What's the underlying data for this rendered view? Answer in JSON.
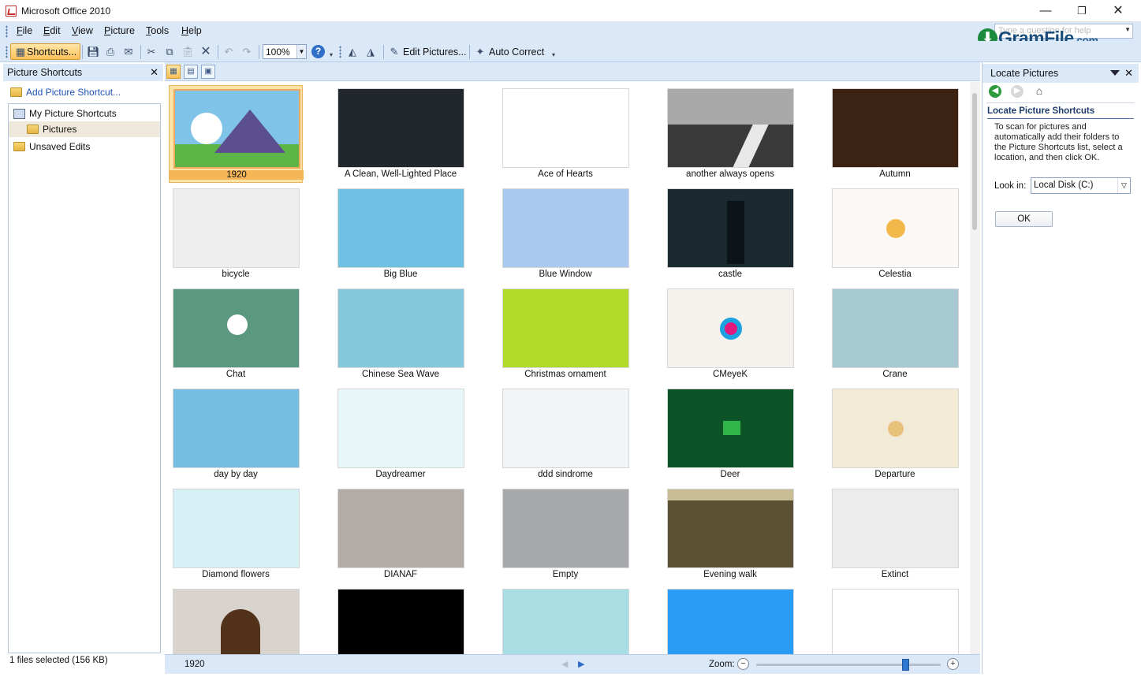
{
  "window": {
    "title": "Microsoft Office 2010"
  },
  "menu": {
    "items": [
      "File",
      "Edit",
      "View",
      "Picture",
      "Tools",
      "Help"
    ],
    "help_placeholder": "Type a question for help"
  },
  "watermark": {
    "text": "GramFile",
    "suffix": ".com"
  },
  "toolbar": {
    "shortcuts_label": "Shortcuts...",
    "zoom_value": "100%",
    "edit_pictures_label": "Edit Pictures...",
    "auto_correct_label": "Auto Correct"
  },
  "left_panel": {
    "title": "Picture Shortcuts",
    "add_link": "Add Picture Shortcut...",
    "tree": [
      "My Picture Shortcuts",
      "Pictures",
      "Unsaved Edits"
    ],
    "status": "1 files selected (156 KB)"
  },
  "gallery": {
    "selected": "1920",
    "items": [
      "1920",
      "A Clean, Well-Lighted Place",
      "Ace of Hearts",
      "another always opens",
      "Autumn",
      "bicycle",
      "Big Blue",
      "Blue Window",
      "castle",
      "Celestia",
      "Chat",
      "Chinese Sea Wave",
      "Christmas ornament",
      "CMeyeK",
      "Crane",
      "day by day",
      "Daydreamer",
      "ddd sindrome",
      "Deer",
      "Departure",
      "Diamond flowers",
      "DIANAF",
      "Empty",
      "Evening walk",
      "Extinct",
      "",
      "",
      "",
      "",
      ""
    ],
    "colors": [
      "#7fc3e8",
      "#22262d",
      "#ffffff",
      "#3a3a3a",
      "#3b2213",
      "#eeeeee",
      "#6fc0e3",
      "#a9c9f0",
      "#1b2a30",
      "#fbf8f6",
      "#5a9880",
      "#86c9dc",
      "#b1d928",
      "#f5f1ec",
      "#a6c9d2",
      "#74bde0",
      "#e7f6f9",
      "#f2f5f7",
      "#0c5428",
      "#f3ebd5",
      "#d6f1f6",
      "#b2aca6",
      "#a6a8ab",
      "#5b5135",
      "#ececec",
      "#d8d3cc",
      "#000000",
      "#a7dde3",
      "#2a9cf5",
      "#ffffff"
    ]
  },
  "statusbar": {
    "current": "1920",
    "zoom_label": "Zoom:",
    "zoom_level": 0.82
  },
  "task_pane": {
    "title": "Locate Pictures",
    "section_title": "Locate Picture Shortcuts",
    "description": "To scan for pictures and automatically add their folders to the Picture Shortcuts list, select a location, and then click OK.",
    "look_in_label": "Look in:",
    "look_in_value": "Local Disk (C:)",
    "ok_label": "OK"
  }
}
